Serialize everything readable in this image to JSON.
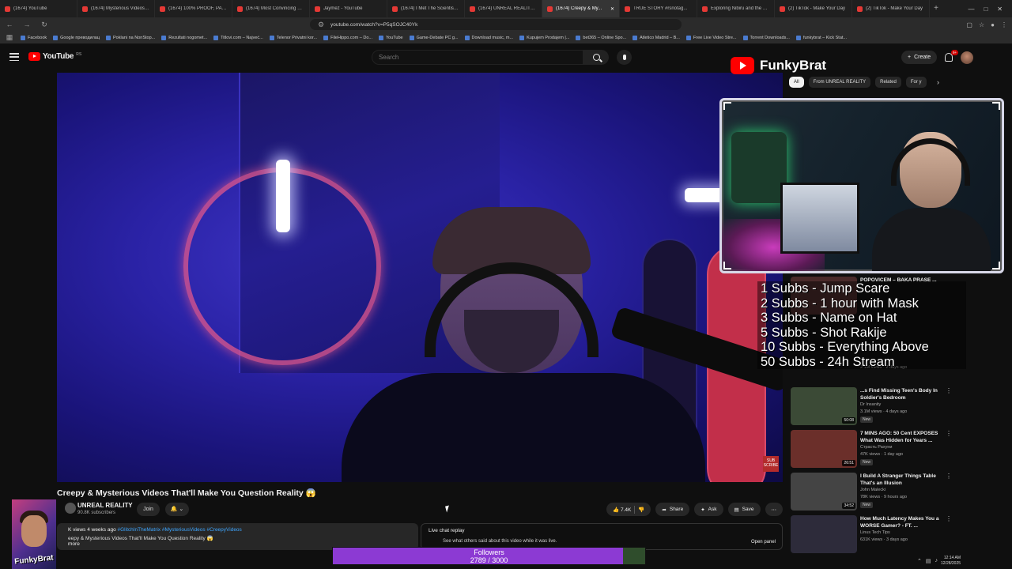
{
  "browser": {
    "tabs": [
      {
        "label": "(1674) YouTube",
        "active": false
      },
      {
        "label": "(1674) Mysterious Videos Y...",
        "active": false
      },
      {
        "label": "(1674) 100% PROOF, PARA...",
        "active": false
      },
      {
        "label": "(1674) Most Convincing Evi...",
        "active": false
      },
      {
        "label": "Jaymez - YouTube",
        "active": false
      },
      {
        "label": "(1674) I Met The Scientist T...",
        "active": false
      },
      {
        "label": "(1674) UNREAL REALITY - Y...",
        "active": false
      },
      {
        "label": "(1674) Creepy & My...",
        "active": true
      },
      {
        "label": "TRUE STORY #rsnotag...",
        "active": false
      },
      {
        "label": "Exploring Nibiru and the N...",
        "active": false
      },
      {
        "label": "(2) TikTok - Make Your Day",
        "active": false
      },
      {
        "label": "(2) TikTok - Make Your Day",
        "active": false
      }
    ],
    "new_tab": "+",
    "url": "youtube.com/watch?v=P5qSOJC40Yk",
    "bookmarks": [
      "Facebook",
      "Google преводилац",
      "Poklani na NonStop...",
      "Rezultati nogomet...",
      "Titlovi.com – Najveć...",
      "Telenor Privatni kor...",
      "FileHippo.com – Do...",
      "YouTube",
      "Game-Debate PC g...",
      "Download music, m...",
      "Kupujem Prodajem |...",
      "bet365 – Online Spo...",
      "Atletico Madrid – B...",
      "Free Live Video Stre...",
      "Torrent Downloads...",
      "funkybrat – Kick Stat..."
    ]
  },
  "youtube": {
    "logo_text": "YouTube",
    "country_code": "RS",
    "search_placeholder": "Search",
    "create_label": "Create",
    "notification_count": "9+"
  },
  "video": {
    "title": "Creepy & Mysterious Videos That'll Make You Question Reality 😱",
    "channel": "UNREAL REALITY",
    "subscribers": "90.8K subscribers",
    "join_label": "Join",
    "likes": "7.4K",
    "share_label": "Share",
    "ask_label": "Ask",
    "save_label": "Save",
    "desc_stats": "K views  4 weeks ago",
    "desc_tags": "#GlitchInTheMatrix #MysteriousVideos #CreepyVideos",
    "desc_line2": "eepy & Mysterious Videos That'll Make You Question Reality 😱",
    "desc_more": "more",
    "sub_badge": "SUB SCRIBE",
    "live_chat_title": "Live chat replay",
    "live_chat_sub": "See what others said about this video while it was live.",
    "open_panel": "Open panel"
  },
  "sidebar": {
    "chips": [
      "All",
      "From UNREAL REALITY",
      "Related",
      "For y"
    ],
    "partial_title": "POPOVICEM – BAKA PRASE ...",
    "partial_meta": "2.1M views · 2 days ago",
    "items": [
      {
        "title": "...s Find Missing Teen's Body In Soldier's Bedroom",
        "channel": "Dr Insanity",
        "meta": "3.1M views · 4 days ago",
        "duration": "50:08",
        "badge": "New",
        "thumb": "#3b4a36"
      },
      {
        "title": "7 MINS AGO: 50 Cent EXPOSES What Was Hidden for Years ...",
        "channel": "Страсть Рахуни",
        "meta": "47K views · 1 day ago",
        "duration": "26:51",
        "badge": "New",
        "thumb": "#6b2f2a"
      },
      {
        "title": "I Build A Stranger Things Table That's an Illusion",
        "channel": "John Malecki",
        "meta": "78K views · 9 hours ago",
        "duration": "34:52",
        "badge": "New",
        "thumb": "#444"
      },
      {
        "title": "How Much Latency Makes You a WORSE Gamer? - FT. ...",
        "channel": "Linus Tech Tips",
        "meta": "631K views · 3 days ago",
        "duration": "",
        "badge": "",
        "thumb": "#2d2b3a"
      }
    ]
  },
  "stream": {
    "brand": "FunkyBrat",
    "goals": [
      "1 Subbs - Jump Scare",
      "2 Subbs - 1 hour with Mask",
      "3 Subbs - Name on Hat",
      "5 Subbs - Shot Rakije",
      "10 Subbs - Everything Above",
      "50 Subbs - 24h Stream"
    ],
    "avatar_label": "FunkyBrat",
    "followers_title": "Followers",
    "followers_text": "2789 / 3000",
    "followers_fraction": 0.93
  },
  "taskbar": {
    "time": "12:14 AM",
    "date": "12/28/2025"
  },
  "colors": {
    "youtube_red": "#ff0000",
    "follower_fill": "#8c3ad3",
    "follower_track": "#2f4d2c",
    "link_blue": "#3ea6ff"
  }
}
